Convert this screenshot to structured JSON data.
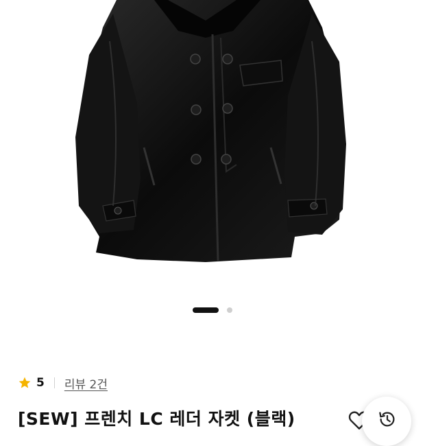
{
  "product": {
    "image_alt": "black leather double-breasted jacket",
    "gallery": {
      "total": 2,
      "active": 1
    },
    "rating": {
      "star_icon": "star-icon",
      "score": "5"
    },
    "review_link": "리뷰 2건",
    "title": "[SEW] 프렌치 LC 레더 자켓 (블랙)"
  },
  "actions": {
    "wishlist_icon": "heart-icon",
    "recent_icon": "history-icon"
  },
  "colors": {
    "star": "#f5b400",
    "active_dot": "#111111",
    "inactive_dot": "#cfcfcf"
  }
}
